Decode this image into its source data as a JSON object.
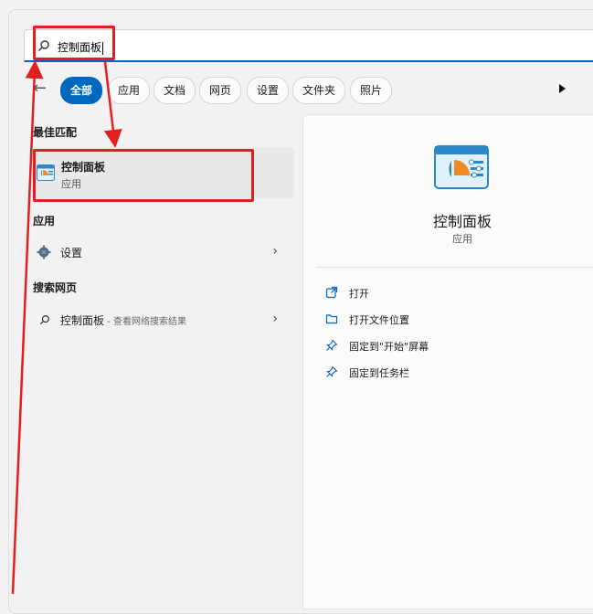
{
  "search": {
    "query": "控制面板"
  },
  "filters": {
    "back_icon": "back-arrow-icon",
    "chips": [
      "全部",
      "应用",
      "文档",
      "网页",
      "设置",
      "文件夹",
      "照片"
    ],
    "active_index": 0,
    "more_icon": "play-icon"
  },
  "best_match": {
    "heading": "最佳匹配",
    "name": "控制面板",
    "type": "应用"
  },
  "apps": {
    "heading": "应用",
    "items": [
      {
        "label": "设置",
        "icon": "gear-icon"
      }
    ]
  },
  "web": {
    "heading": "搜索网页",
    "query": "控制面板",
    "suffix": " - 查看网络搜索结果"
  },
  "preview": {
    "title": "控制面板",
    "subtitle": "应用",
    "actions": [
      {
        "label": "打开",
        "icon": "open-external-icon"
      },
      {
        "label": "打开文件位置",
        "icon": "folder-icon"
      },
      {
        "label": "固定到\"开始\"屏幕",
        "icon": "pin-icon"
      },
      {
        "label": "固定到任务栏",
        "icon": "pin-icon"
      }
    ]
  },
  "colors": {
    "accent": "#0067c0",
    "highlight": "#e02020"
  }
}
